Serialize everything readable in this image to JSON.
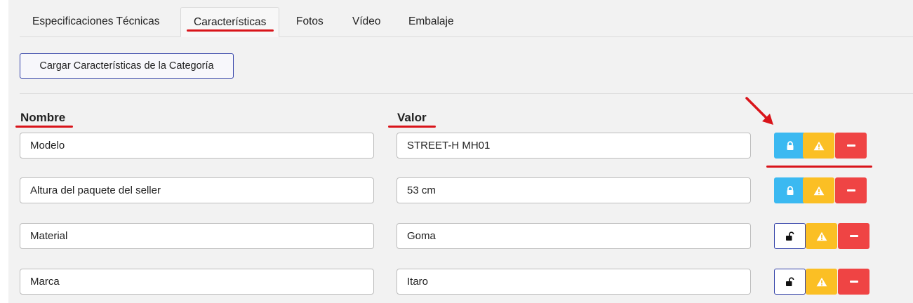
{
  "tabs": [
    {
      "label": "Especificaciones Técnicas"
    },
    {
      "label": "Características"
    },
    {
      "label": "Fotos"
    },
    {
      "label": "Vídeo"
    },
    {
      "label": "Embalaje"
    }
  ],
  "active_tab": "Características",
  "load_button": "Cargar Características de la Categoría",
  "columns": {
    "name": "Nombre",
    "value": "Valor"
  },
  "rows": [
    {
      "name": "Modelo",
      "value": "STREET-H MH01",
      "locked": true
    },
    {
      "name": "Altura del paquete del seller",
      "value": "53 cm",
      "locked": true
    },
    {
      "name": "Material",
      "value": "Goma",
      "locked": false
    },
    {
      "name": "Marca",
      "value": "Itaro",
      "locked": false
    }
  ],
  "icons": {
    "locked": "lock-icon",
    "unlocked": "unlock-icon",
    "warning": "warning-icon",
    "remove": "minus-icon"
  },
  "colors": {
    "lock_active": "#3bb9f1",
    "warning": "#fbbf24",
    "remove": "#ef4444",
    "outline": "#3140a8",
    "annotation": "#d9141a"
  }
}
